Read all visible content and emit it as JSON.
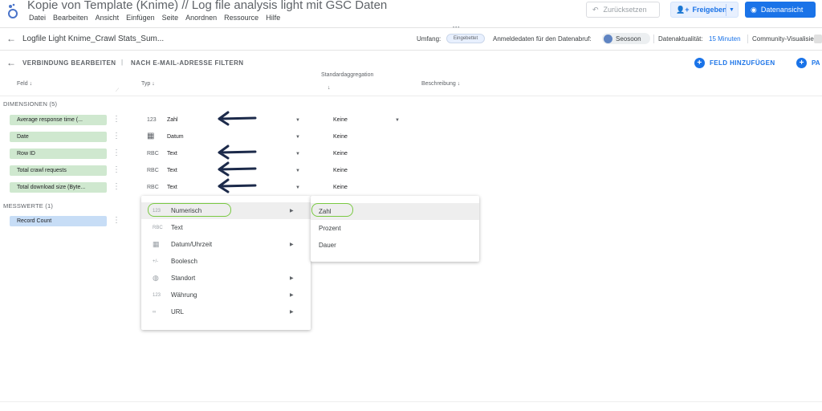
{
  "header": {
    "title": "Kopie von  Template (Knime) // Log file analysis light mit GSC Daten",
    "menu": [
      "Datei",
      "Bearbeiten",
      "Ansicht",
      "Einfügen",
      "Seite",
      "Anordnen",
      "Ressource",
      "Hilfe"
    ],
    "reset_label": "Zurücksetzen",
    "share_label": "Freigeben",
    "view_label": "Datenansicht"
  },
  "datasource": {
    "name": "Logfile Light Knime_Crawl Stats_Sum...",
    "scope_label": "Umfang:",
    "scope_value": "Eingebettet",
    "credentials_label": "Anmeldedaten für den Datenabruf:",
    "credentials_value": "Seosoon",
    "freshness_label": "Datenaktualität:",
    "freshness_value": "15 Minuten",
    "community_label": "Community-Visualisier"
  },
  "actions": {
    "edit_connection": "VERBINDUNG BEARBEITEN",
    "separator": "|",
    "email_filter": "NACH E-MAIL-ADRESSE FILTERN",
    "add_field": "FELD HINZUFÜGEN",
    "add_param": "PA"
  },
  "columns": {
    "field": "Feld",
    "type": "Typ",
    "aggregation": "Standardaggregation",
    "description": "Beschreibung"
  },
  "dimensions": {
    "label": "DIMENSIONEN (5)",
    "rows": [
      {
        "name": "Average response time (...",
        "type_icon": "123",
        "type": "Zahl",
        "agg": "Keine"
      },
      {
        "name": "Date",
        "type_icon": "▦",
        "type": "Datum",
        "agg": "Keine"
      },
      {
        "name": "Row ID",
        "type_icon": "RBC",
        "type": "Text",
        "agg": "Keine"
      },
      {
        "name": "Total crawl requests",
        "type_icon": "RBC",
        "type": "Text",
        "agg": "Keine"
      },
      {
        "name": "Total download size (Byte...",
        "type_icon": "RBC",
        "type": "Text",
        "agg": "Keine"
      }
    ]
  },
  "metrics": {
    "label": "MESSWERTE (1)",
    "rows": [
      {
        "name": "Record Count"
      }
    ]
  },
  "type_menu": {
    "items": [
      {
        "icon": "123",
        "label": "Numerisch"
      },
      {
        "icon": "RBC",
        "label": "Text"
      },
      {
        "icon": "▦",
        "label": "Datum/Uhrzeit"
      },
      {
        "icon": "+/-",
        "label": "Boolesch"
      },
      {
        "icon": "◍",
        "label": "Standort"
      },
      {
        "icon": "123",
        "label": "Währung"
      },
      {
        "icon": "∞",
        "label": "URL"
      }
    ],
    "submenu": [
      "Zahl",
      "Prozent",
      "Dauer"
    ]
  },
  "colors": {
    "accent": "#1a73e8",
    "dimension_chip": "#cfe8cf",
    "metric_chip": "#c7ddf6",
    "annotation_green": "#7ac943",
    "annotation_arrow": "#1c2a4a"
  }
}
